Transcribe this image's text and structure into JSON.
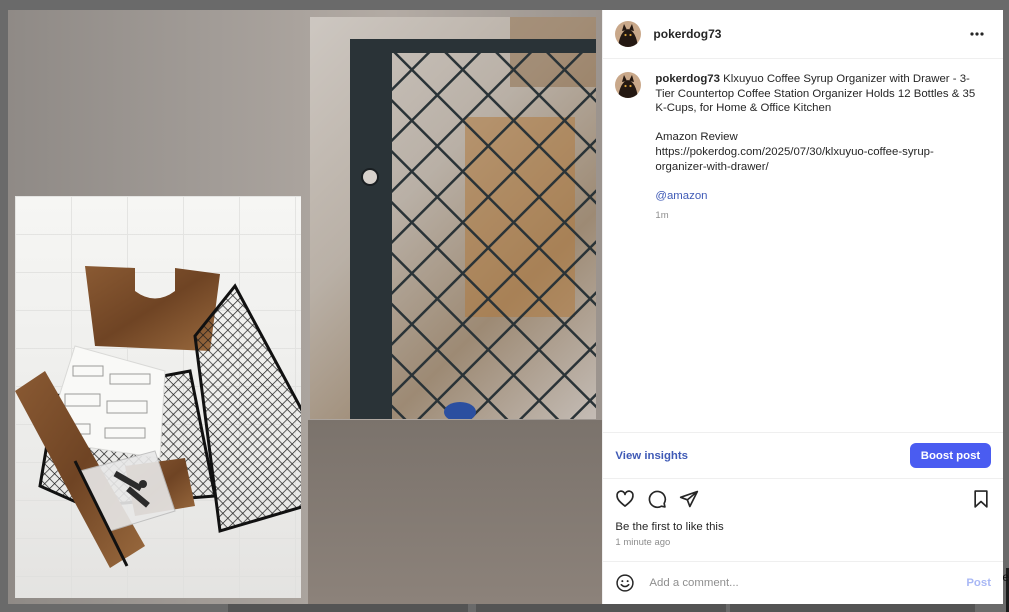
{
  "post": {
    "username": "pokerdog73",
    "caption_user": "pokerdog73",
    "caption_title": "Klxuyuo Coffee Syrup Organizer with Drawer - 3-Tier Countertop Coffee Station Organizer Holds 12 Bottles & 35 K-Cups, for Home & Office Kitchen",
    "caption_line2": "Amazon Review",
    "caption_link": "https://pokerdog.com/2025/07/30/klxuyuo-coffee-syrup-organizer-with-drawer/",
    "mention": "@amazon",
    "caption_age": "1m",
    "likes_text": "Be the first to like this",
    "time_text": "1 minute ago"
  },
  "actions": {
    "insights_label": "View insights",
    "boost_label": "Boost post"
  },
  "comment": {
    "placeholder": "Add a comment...",
    "post_label": "Post"
  },
  "icons": {
    "more": "more-horizontal-icon",
    "like": "heart-icon",
    "comment": "comment-icon",
    "share": "share-icon",
    "save": "bookmark-icon",
    "emoji": "emoji-icon"
  },
  "colors": {
    "accent": "#4a5cf1",
    "link": "#3f5ab6",
    "muted": "#8e8e8e",
    "post_disabled": "#a9b8f5"
  },
  "background": {
    "letter": "e"
  }
}
